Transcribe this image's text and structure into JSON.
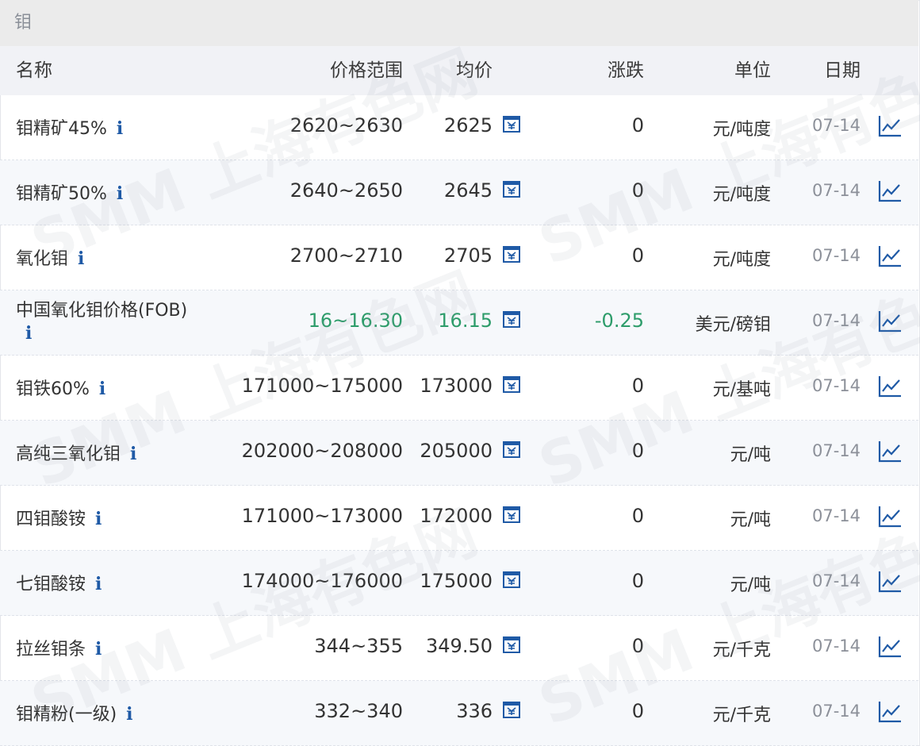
{
  "title": "钼",
  "headers": {
    "name": "名称",
    "range": "价格范围",
    "avg": "均价",
    "change": "涨跌",
    "unit": "单位",
    "date": "日期"
  },
  "watermark": "SMM 上海有色网",
  "colors": {
    "positive_text": "#333333",
    "negative": "#2d9c6a",
    "info_icon": "#1f5aa6"
  },
  "rows": [
    {
      "name": "钼精矿45%",
      "info": "i",
      "range": "2620~2630",
      "avg": "2625",
      "change": "0",
      "unit": "元/吨度",
      "date": "07-14"
    },
    {
      "name": "钼精矿50%",
      "info": "i",
      "range": "2640~2650",
      "avg": "2645",
      "change": "0",
      "unit": "元/吨度",
      "date": "07-14"
    },
    {
      "name": "氧化钼",
      "info": "i",
      "range": "2700~2710",
      "avg": "2705",
      "change": "0",
      "unit": "元/吨度",
      "date": "07-14"
    },
    {
      "name": "中国氧化钼价格(FOB)",
      "info": "i",
      "range": "16~16.30",
      "avg": "16.15",
      "change": "-0.25",
      "unit": "美元/磅钼",
      "date": "07-14"
    },
    {
      "name": "钼铁60%",
      "info": "i",
      "range": "171000~175000",
      "avg": "173000",
      "change": "0",
      "unit": "元/基吨",
      "date": "07-14"
    },
    {
      "name": "高纯三氧化钼",
      "info": "i",
      "range": "202000~208000",
      "avg": "205000",
      "change": "0",
      "unit": "元/吨",
      "date": "07-14"
    },
    {
      "name": "四钼酸铵",
      "info": "i",
      "range": "171000~173000",
      "avg": "172000",
      "change": "0",
      "unit": "元/吨",
      "date": "07-14"
    },
    {
      "name": "七钼酸铵",
      "info": "i",
      "range": "174000~176000",
      "avg": "175000",
      "change": "0",
      "unit": "元/吨",
      "date": "07-14"
    },
    {
      "name": "拉丝钼条",
      "info": "i",
      "range": "344~355",
      "avg": "349.50",
      "change": "0",
      "unit": "元/千克",
      "date": "07-14"
    },
    {
      "name": "钼精粉(一级)",
      "info": "i",
      "range": "332~340",
      "avg": "336",
      "change": "0",
      "unit": "元/千克",
      "date": "07-14"
    }
  ]
}
